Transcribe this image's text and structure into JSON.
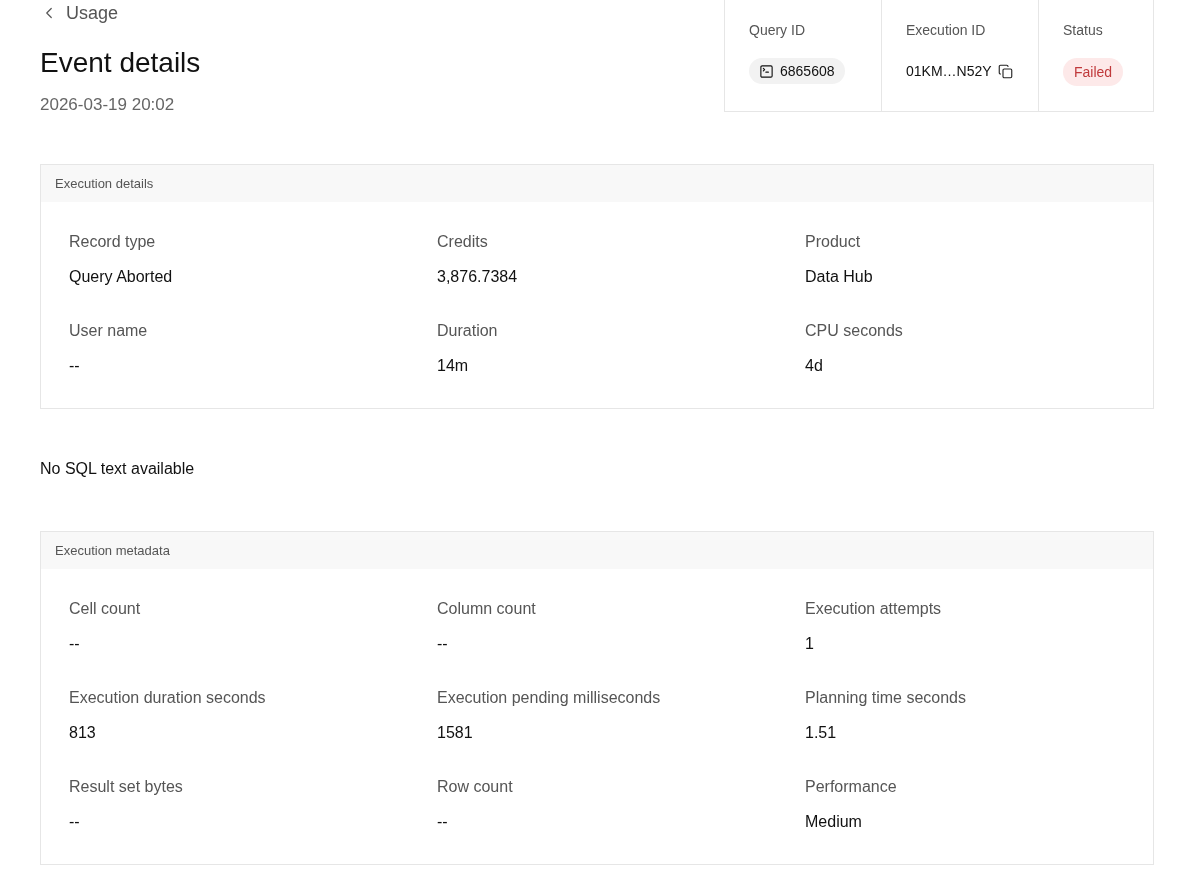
{
  "back_link": {
    "label": "Usage"
  },
  "page": {
    "title": "Event details",
    "timestamp": "2026-03-19 20:02"
  },
  "summary": [
    {
      "kind": "query_id",
      "label": "Query ID",
      "value": "6865608"
    },
    {
      "kind": "execution_id",
      "label": "Execution ID",
      "value": "01KM…N52Y"
    },
    {
      "kind": "status",
      "label": "Status",
      "value": "Failed"
    }
  ],
  "execution_details": {
    "title": "Execution details",
    "fields": [
      {
        "label": "Record type",
        "value": "Query Aborted"
      },
      {
        "label": "Credits",
        "value": "3,876.7384"
      },
      {
        "label": "Product",
        "value": "Data Hub"
      },
      {
        "label": "User name",
        "value": "--"
      },
      {
        "label": "Duration",
        "value": "14m"
      },
      {
        "label": "CPU seconds",
        "value": "4d"
      }
    ]
  },
  "sql_text": {
    "message": "No SQL text available"
  },
  "execution_metadata": {
    "title": "Execution metadata",
    "fields": [
      {
        "label": "Cell count",
        "value": "--"
      },
      {
        "label": "Column count",
        "value": "--"
      },
      {
        "label": "Execution attempts",
        "value": "1"
      },
      {
        "label": "Execution duration seconds",
        "value": "813"
      },
      {
        "label": "Execution pending milliseconds",
        "value": "1581"
      },
      {
        "label": "Planning time seconds",
        "value": "1.51"
      },
      {
        "label": "Result set bytes",
        "value": "--"
      },
      {
        "label": "Row count",
        "value": "--"
      },
      {
        "label": "Performance",
        "value": "Medium"
      }
    ]
  }
}
